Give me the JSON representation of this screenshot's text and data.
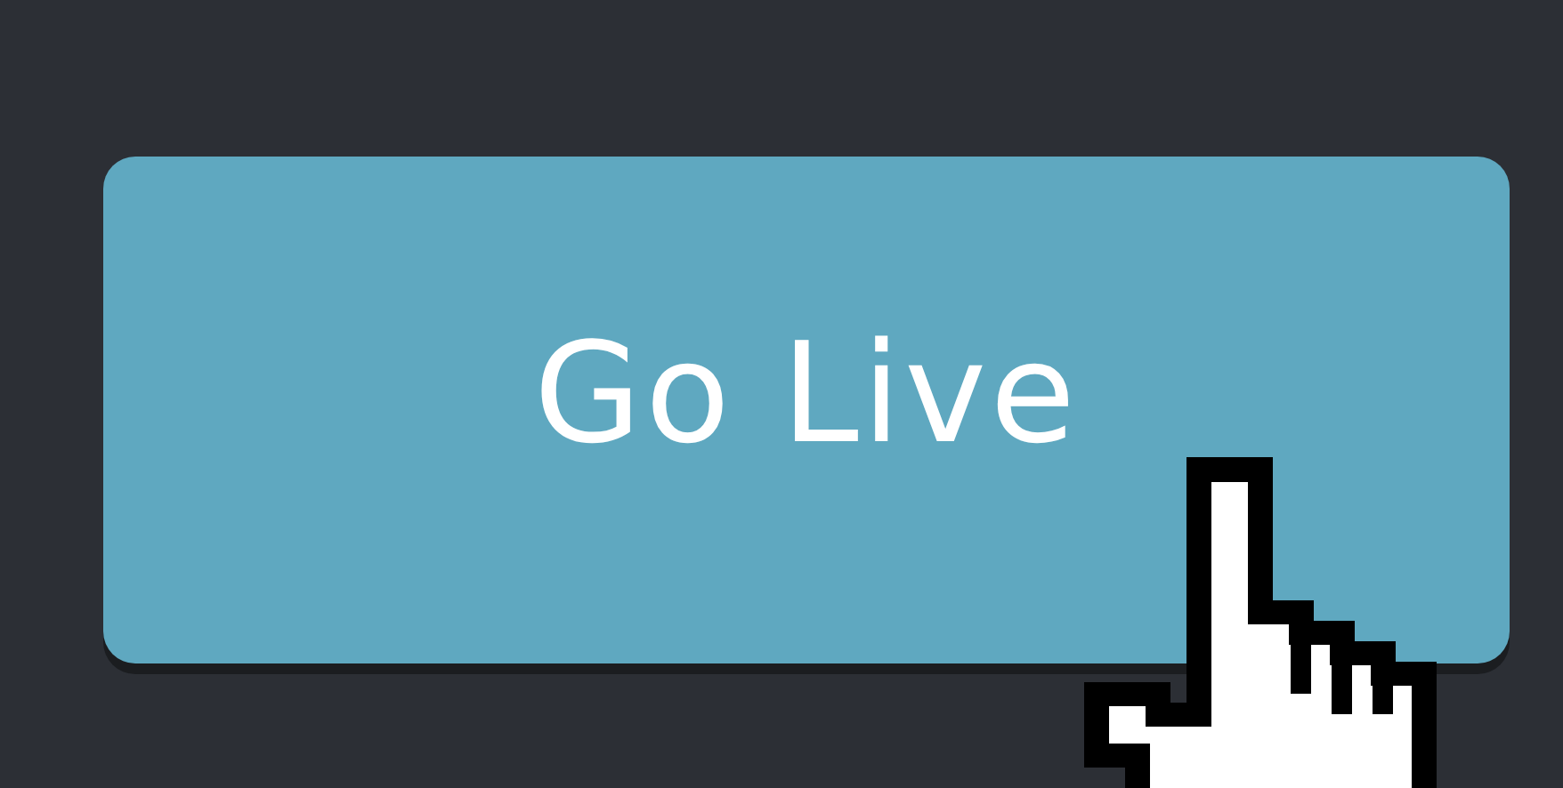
{
  "button": {
    "label": "Go Live"
  }
}
